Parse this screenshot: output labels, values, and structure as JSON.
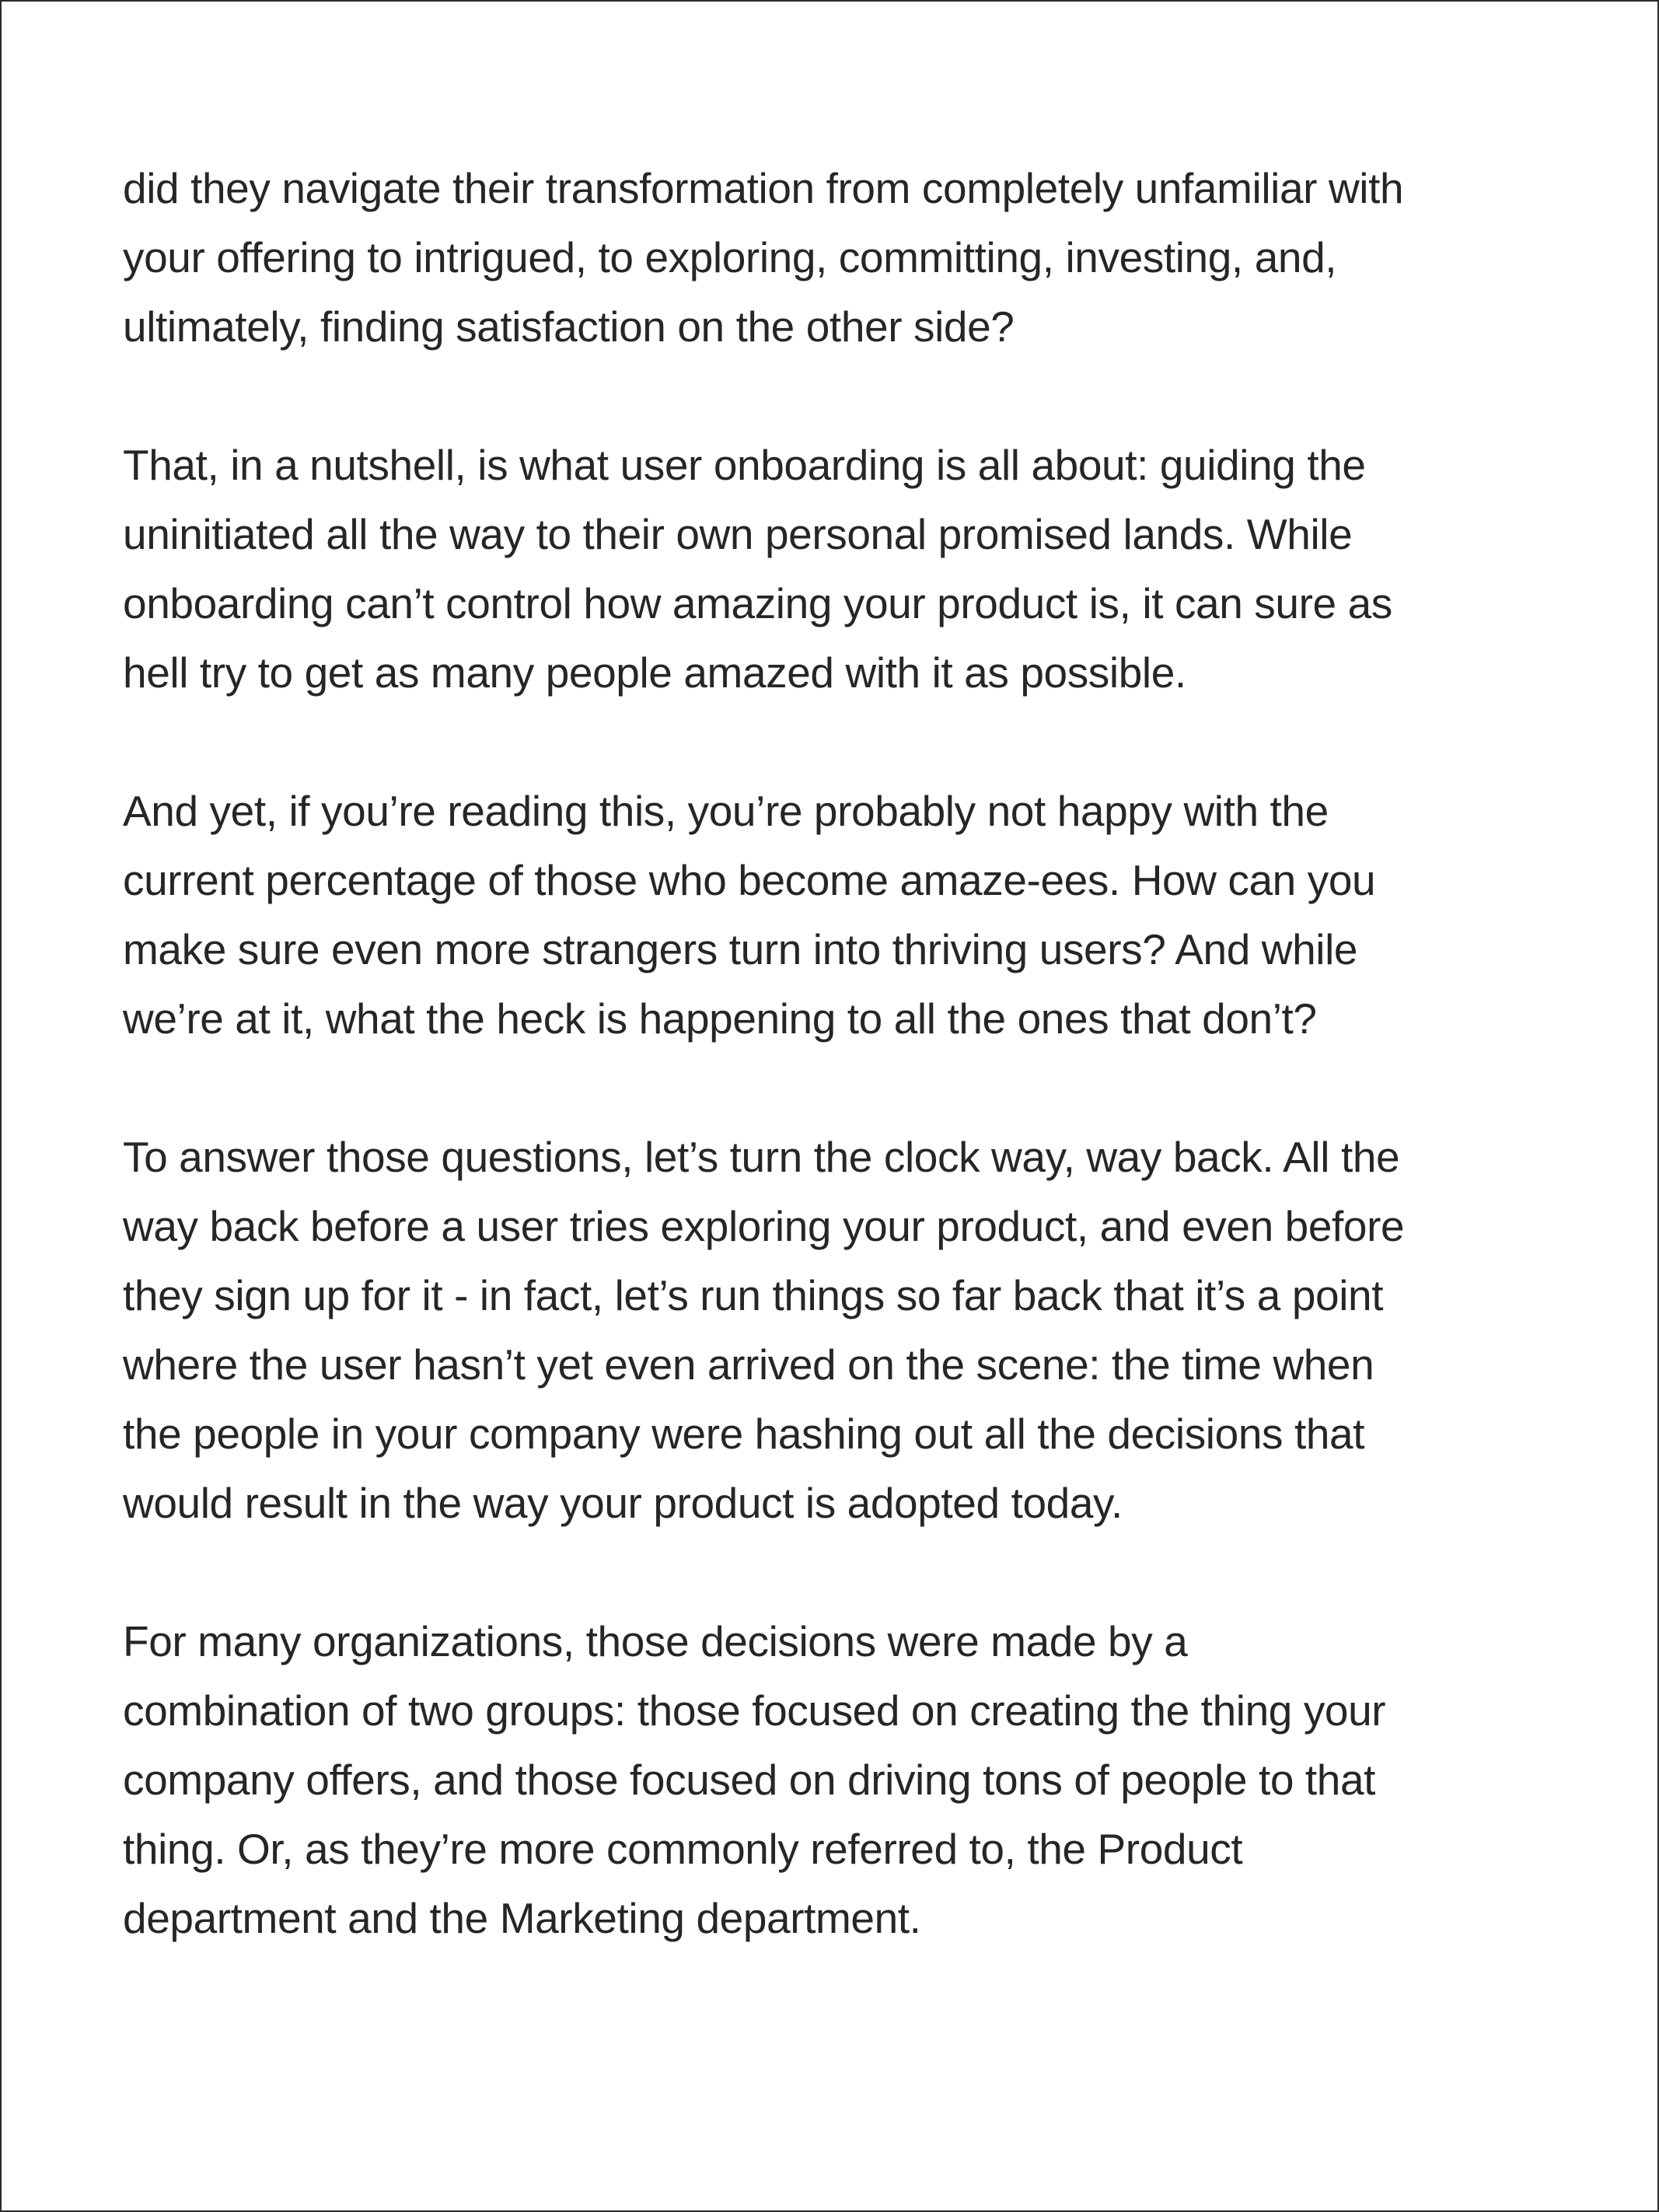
{
  "paragraphs": [
    {
      "lines": [
        "did they navigate their transformation from completely unfamiliar with",
        "your offering to intrigued, to exploring, committing, investing, and,",
        "ultimately, finding satisfaction on the other side?"
      ]
    },
    {
      "lines": [
        "That, in a nutshell, is what user onboarding is all about: guiding the",
        "uninitiated all the way to their own personal promised lands. While",
        "onboarding can’t control how amazing your product is, it can sure as",
        "hell try to get as many people amazed with it as possible."
      ]
    },
    {
      "lines": [
        "And yet, if you’re reading this, you’re probably not happy with the",
        "current percentage of those who become amaze-ees. How can you",
        "make sure even more strangers turn into thriving users? And while",
        "we’re at it, what the heck is happening to all the ones that don’t?"
      ]
    },
    {
      "lines": [
        "To answer those questions, let’s turn the clock way, way back. All the",
        "way back before a user tries exploring your product, and even before",
        "they sign up for it - in fact, let’s run things so far back that it’s a point",
        "where the user hasn’t yet even arrived on the scene: the time when",
        "the people in your company were hashing out all the decisions that",
        "would result in the way your product is adopted today."
      ]
    },
    {
      "lines": [
        "For many organizations, those decisions were made by a",
        "combination of two groups: those focused on creating the thing your",
        "company offers, and those focused on driving tons of people to that",
        "thing. Or, as they’re more commonly referred to, the Product",
        "department and the Marketing department."
      ]
    }
  ]
}
